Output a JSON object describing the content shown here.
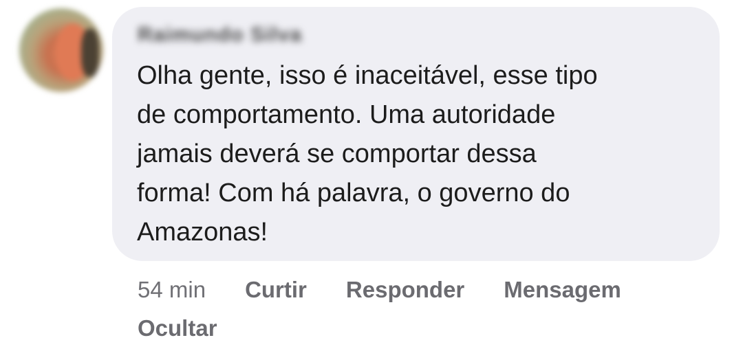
{
  "comment": {
    "author": "Raimundo Silva",
    "text": "Olha gente, isso é inaceitável, esse tipo de comportamento. Uma autoridade jamais deverá se comportar dessa forma! Com há palavra, o governo do Amazonas!",
    "lines": [
      "Olha gente, isso é inaceitável, esse tipo",
      "de comportamento. Uma autoridade",
      "jamais deverá se comportar dessa",
      "forma! Com há palavra, o governo do",
      "Amazonas!"
    ]
  },
  "actions": {
    "timestamp": "54 min",
    "like_label": "Curtir",
    "reply_label": "Responder",
    "message_label": "Mensagem",
    "hide_label": "Ocultar"
  },
  "colors": {
    "bubble": "#efeff4",
    "text": "#1c1c1c",
    "actions": "#6b6b70"
  }
}
